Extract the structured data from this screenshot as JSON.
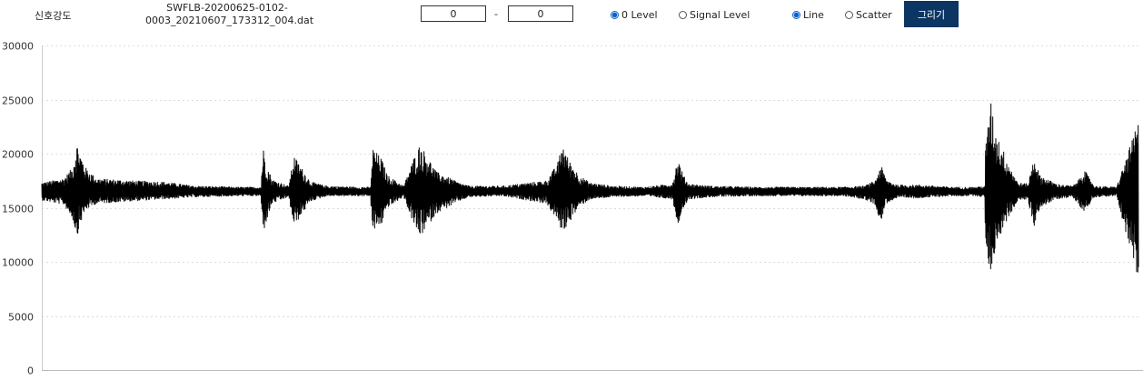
{
  "header": {
    "title": "신호강도",
    "file_name_line1": "SWFLB-20200625-0102-",
    "file_name_line2": "0003_20210607_173312_004.dat"
  },
  "range": {
    "from": "0",
    "separator": "-",
    "to": "0"
  },
  "level_options": [
    {
      "label": "0 Level",
      "checked": true
    },
    {
      "label": "Signal Level",
      "checked": false
    }
  ],
  "plot_options": [
    {
      "label": "Line",
      "checked": true
    },
    {
      "label": "Scatter",
      "checked": false
    }
  ],
  "draw_button_label": "그리기",
  "chart_data": {
    "type": "line",
    "ylim": [
      0,
      30000
    ],
    "yticks": [
      0,
      5000,
      10000,
      15000,
      20000,
      25000,
      30000
    ],
    "grid": true,
    "baseline": 16500,
    "line_color": "#000000",
    "series": [
      {
        "envelope_x": [
          0,
          0.02,
          0.028,
          0.032,
          0.035,
          0.04,
          0.05,
          0.08,
          0.11,
          0.14,
          0.18,
          0.2,
          0.2,
          0.202,
          0.205,
          0.21,
          0.225,
          0.23,
          0.245,
          0.26,
          0.29,
          0.3,
          0.3,
          0.302,
          0.31,
          0.315,
          0.33,
          0.34,
          0.345,
          0.36,
          0.375,
          0.38,
          0.39,
          0.42,
          0.46,
          0.47,
          0.475,
          0.48,
          0.49,
          0.5,
          0.52,
          0.55,
          0.575,
          0.58,
          0.585,
          0.59,
          0.61,
          0.65,
          0.7,
          0.73,
          0.75,
          0.76,
          0.765,
          0.77,
          0.78,
          0.8,
          0.83,
          0.85,
          0.86,
          0.86,
          0.865,
          0.87,
          0.88,
          0.89,
          0.9,
          0.9,
          0.905,
          0.91,
          0.925,
          0.94,
          0.945,
          0.95,
          0.96,
          0.98,
          1.0
        ],
        "envelope_upper": [
          17300,
          17700,
          18700,
          21000,
          20000,
          18700,
          17700,
          17500,
          17400,
          17000,
          16900,
          16900,
          17500,
          20500,
          19000,
          17600,
          17000,
          19800,
          17400,
          17000,
          16900,
          16900,
          18000,
          20500,
          19500,
          18000,
          17000,
          19800,
          20900,
          18300,
          17600,
          17300,
          17000,
          17000,
          17500,
          19000,
          21000,
          19500,
          18000,
          17300,
          17000,
          16900,
          17200,
          19600,
          18000,
          17200,
          17000,
          16900,
          16900,
          16900,
          17000,
          17500,
          19000,
          17600,
          17100,
          17100,
          16900,
          16900,
          17000,
          20000,
          25000,
          22000,
          19500,
          17300,
          17200,
          17500,
          19800,
          18000,
          17200,
          17000,
          17500,
          18600,
          17000,
          16900,
          23000
        ],
        "envelope_lower": [
          15700,
          15300,
          14000,
          12300,
          13500,
          14800,
          15400,
          15600,
          15800,
          16000,
          16100,
          16100,
          15500,
          12700,
          13800,
          15400,
          16000,
          13300,
          15600,
          16100,
          16100,
          16100,
          14800,
          12800,
          13500,
          15000,
          16000,
          13200,
          12300,
          14500,
          15300,
          15600,
          16000,
          16100,
          15400,
          13800,
          12700,
          13500,
          15100,
          15800,
          16000,
          16100,
          15800,
          13400,
          15000,
          15800,
          16000,
          16100,
          16100,
          16100,
          15800,
          15300,
          13600,
          15400,
          15900,
          15900,
          16100,
          16100,
          16000,
          12000,
          8800,
          11500,
          13800,
          15700,
          15800,
          15300,
          13300,
          15000,
          15800,
          16000,
          15400,
          14500,
          16000,
          16100,
          8000
        ]
      }
    ]
  }
}
